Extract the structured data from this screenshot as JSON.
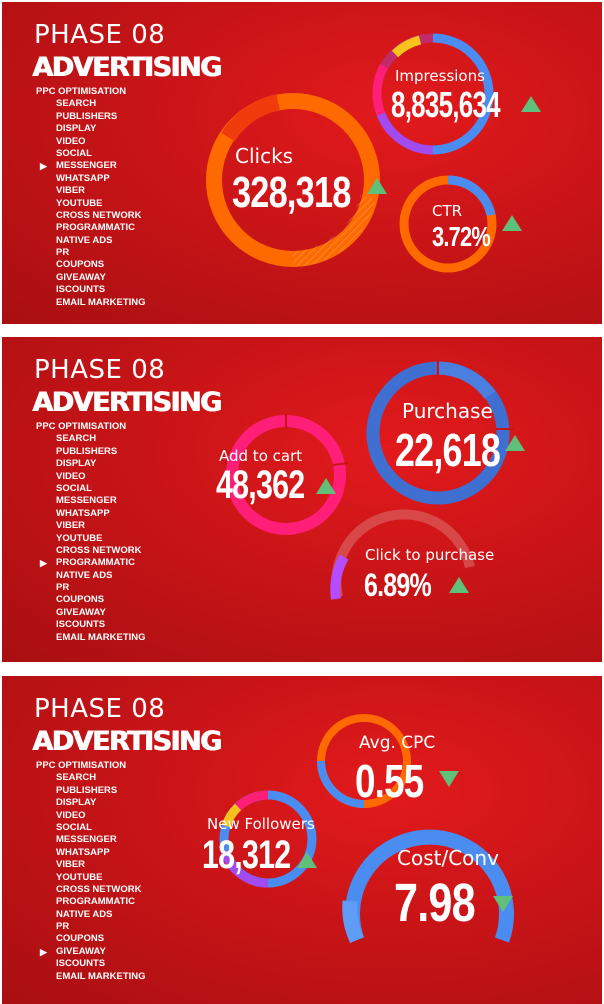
{
  "colors": {
    "panel_red": "#c81417",
    "trend_green": "#5fc07a",
    "orange": "#ff6a00",
    "blue": "#4a8cf0",
    "pink": "#ff1e78",
    "purple": "#a14bf0",
    "yellow": "#f7c21b"
  },
  "menu_items": [
    "PPC OPTIMISATION",
    "SEARCH",
    "PUBLISHERS",
    "DISPLAY",
    "VIDEO",
    "SOCIAL",
    "MESSENGER",
    "WHATSAPP",
    "VIBER",
    "YOUTUBE",
    "CROSS NETWORK",
    "PROGRAMMATIC",
    "NATIVE ADS",
    "PR",
    "COUPONS",
    "GIVEAWAY",
    "ISCOUNTS",
    "EMAIL MARKETING"
  ],
  "panels": [
    {
      "title": "PHASE 08",
      "subtitle": "ADVERTISING",
      "selected_item": "MESSENGER",
      "metrics": {
        "clicks": {
          "label": "Clicks",
          "value": "328,318",
          "trend": "up"
        },
        "impressions": {
          "label": "Impressions",
          "value": "8,835,634",
          "trend": "up"
        },
        "ctr": {
          "label": "CTR",
          "value": "3.72%",
          "trend": "up"
        }
      }
    },
    {
      "title": "PHASE 08",
      "subtitle": "ADVERTISING",
      "selected_item": "PROGRAMMATIC",
      "metrics": {
        "add_to_cart": {
          "label": "Add to cart",
          "value": "48,362",
          "trend": "up"
        },
        "purchase": {
          "label": "Purchase",
          "value": "22,618",
          "trend": "up"
        },
        "click_to_purchase": {
          "label": "Click to purchase",
          "value": "6.89%",
          "trend": "up"
        }
      }
    },
    {
      "title": "PHASE 08",
      "subtitle": "ADVERTISING",
      "selected_item": "GIVEAWAY",
      "metrics": {
        "avg_cpc": {
          "label": "Avg. CPC",
          "value": "0.55",
          "trend": "down"
        },
        "new_followers": {
          "label": "New Followers",
          "value": "18,312",
          "trend": "up"
        },
        "cost_conv": {
          "label": "Cost/Conv",
          "value": "7.98",
          "trend": "down"
        }
      }
    }
  ]
}
